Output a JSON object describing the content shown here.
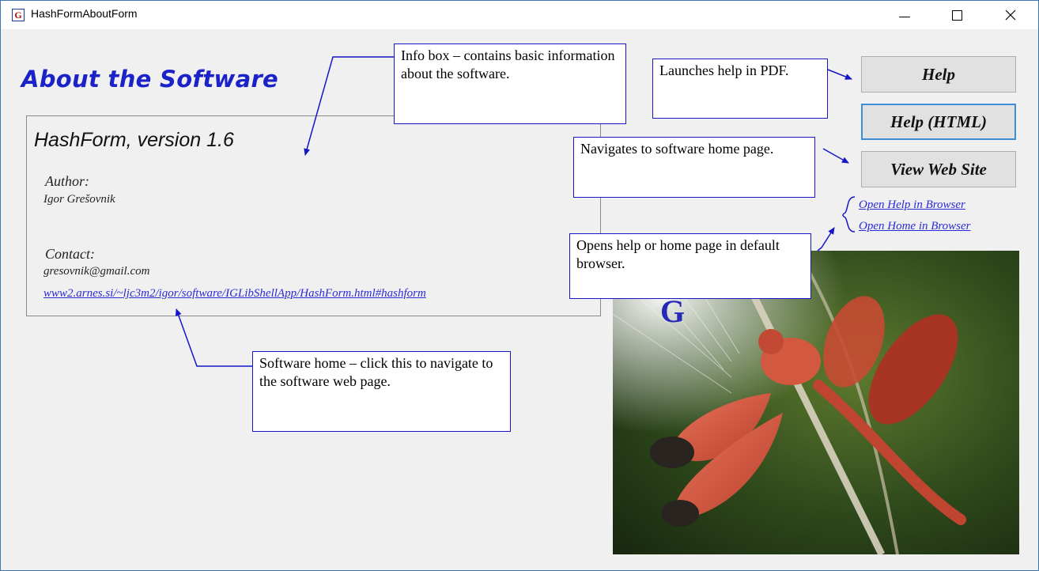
{
  "window": {
    "title": "HashFormAboutForm",
    "app_icon_glyph": "G"
  },
  "heading": "About the Software",
  "info": {
    "product": "HashForm, version 1.6",
    "author_label": "Author:",
    "author": "Igor Grešovnik",
    "contact_label": "Contact:",
    "email": "gresovnik@gmail.com",
    "website": "www2.arnes.si/~ljc3m2/igor/software/IGLibShellApp/HashForm.html#hashform"
  },
  "buttons": {
    "help": "Help",
    "help_html": "Help (HTML)",
    "view_web_site": "View Web Site"
  },
  "links": {
    "open_help": "Open Help in Browser",
    "open_home": "Open Home in Browser"
  },
  "callouts": {
    "info_box": "Info box – contains basic information about the software.",
    "help_pdf": "Launches help in PDF.",
    "home_page": "Navigates to software home page.",
    "browser": "Opens help or home page in default browser.",
    "software_home": "Software home – click this to navigate to the software web page."
  },
  "colors": {
    "heading": "#1b22c7",
    "link": "#2b2bd6",
    "callout_border": "#1616c8",
    "window_border": "#3c78b5"
  },
  "icons": [
    "app-logo-icon",
    "minimize-icon",
    "maximize-icon",
    "close-icon",
    "dragonfly-photo"
  ]
}
